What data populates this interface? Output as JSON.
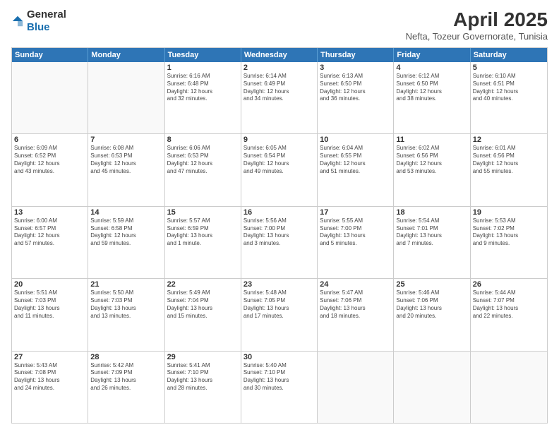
{
  "logo": {
    "general": "General",
    "blue": "Blue"
  },
  "title": {
    "month": "April 2025",
    "location": "Nefta, Tozeur Governorate, Tunisia"
  },
  "header": {
    "days": [
      "Sunday",
      "Monday",
      "Tuesday",
      "Wednesday",
      "Thursday",
      "Friday",
      "Saturday"
    ]
  },
  "rows": [
    [
      {
        "day": "",
        "text": ""
      },
      {
        "day": "",
        "text": ""
      },
      {
        "day": "1",
        "text": "Sunrise: 6:16 AM\nSunset: 6:48 PM\nDaylight: 12 hours\nand 32 minutes."
      },
      {
        "day": "2",
        "text": "Sunrise: 6:14 AM\nSunset: 6:49 PM\nDaylight: 12 hours\nand 34 minutes."
      },
      {
        "day": "3",
        "text": "Sunrise: 6:13 AM\nSunset: 6:50 PM\nDaylight: 12 hours\nand 36 minutes."
      },
      {
        "day": "4",
        "text": "Sunrise: 6:12 AM\nSunset: 6:50 PM\nDaylight: 12 hours\nand 38 minutes."
      },
      {
        "day": "5",
        "text": "Sunrise: 6:10 AM\nSunset: 6:51 PM\nDaylight: 12 hours\nand 40 minutes."
      }
    ],
    [
      {
        "day": "6",
        "text": "Sunrise: 6:09 AM\nSunset: 6:52 PM\nDaylight: 12 hours\nand 43 minutes."
      },
      {
        "day": "7",
        "text": "Sunrise: 6:08 AM\nSunset: 6:53 PM\nDaylight: 12 hours\nand 45 minutes."
      },
      {
        "day": "8",
        "text": "Sunrise: 6:06 AM\nSunset: 6:53 PM\nDaylight: 12 hours\nand 47 minutes."
      },
      {
        "day": "9",
        "text": "Sunrise: 6:05 AM\nSunset: 6:54 PM\nDaylight: 12 hours\nand 49 minutes."
      },
      {
        "day": "10",
        "text": "Sunrise: 6:04 AM\nSunset: 6:55 PM\nDaylight: 12 hours\nand 51 minutes."
      },
      {
        "day": "11",
        "text": "Sunrise: 6:02 AM\nSunset: 6:56 PM\nDaylight: 12 hours\nand 53 minutes."
      },
      {
        "day": "12",
        "text": "Sunrise: 6:01 AM\nSunset: 6:56 PM\nDaylight: 12 hours\nand 55 minutes."
      }
    ],
    [
      {
        "day": "13",
        "text": "Sunrise: 6:00 AM\nSunset: 6:57 PM\nDaylight: 12 hours\nand 57 minutes."
      },
      {
        "day": "14",
        "text": "Sunrise: 5:59 AM\nSunset: 6:58 PM\nDaylight: 12 hours\nand 59 minutes."
      },
      {
        "day": "15",
        "text": "Sunrise: 5:57 AM\nSunset: 6:59 PM\nDaylight: 13 hours\nand 1 minute."
      },
      {
        "day": "16",
        "text": "Sunrise: 5:56 AM\nSunset: 7:00 PM\nDaylight: 13 hours\nand 3 minutes."
      },
      {
        "day": "17",
        "text": "Sunrise: 5:55 AM\nSunset: 7:00 PM\nDaylight: 13 hours\nand 5 minutes."
      },
      {
        "day": "18",
        "text": "Sunrise: 5:54 AM\nSunset: 7:01 PM\nDaylight: 13 hours\nand 7 minutes."
      },
      {
        "day": "19",
        "text": "Sunrise: 5:53 AM\nSunset: 7:02 PM\nDaylight: 13 hours\nand 9 minutes."
      }
    ],
    [
      {
        "day": "20",
        "text": "Sunrise: 5:51 AM\nSunset: 7:03 PM\nDaylight: 13 hours\nand 11 minutes."
      },
      {
        "day": "21",
        "text": "Sunrise: 5:50 AM\nSunset: 7:03 PM\nDaylight: 13 hours\nand 13 minutes."
      },
      {
        "day": "22",
        "text": "Sunrise: 5:49 AM\nSunset: 7:04 PM\nDaylight: 13 hours\nand 15 minutes."
      },
      {
        "day": "23",
        "text": "Sunrise: 5:48 AM\nSunset: 7:05 PM\nDaylight: 13 hours\nand 17 minutes."
      },
      {
        "day": "24",
        "text": "Sunrise: 5:47 AM\nSunset: 7:06 PM\nDaylight: 13 hours\nand 18 minutes."
      },
      {
        "day": "25",
        "text": "Sunrise: 5:46 AM\nSunset: 7:06 PM\nDaylight: 13 hours\nand 20 minutes."
      },
      {
        "day": "26",
        "text": "Sunrise: 5:44 AM\nSunset: 7:07 PM\nDaylight: 13 hours\nand 22 minutes."
      }
    ],
    [
      {
        "day": "27",
        "text": "Sunrise: 5:43 AM\nSunset: 7:08 PM\nDaylight: 13 hours\nand 24 minutes."
      },
      {
        "day": "28",
        "text": "Sunrise: 5:42 AM\nSunset: 7:09 PM\nDaylight: 13 hours\nand 26 minutes."
      },
      {
        "day": "29",
        "text": "Sunrise: 5:41 AM\nSunset: 7:10 PM\nDaylight: 13 hours\nand 28 minutes."
      },
      {
        "day": "30",
        "text": "Sunrise: 5:40 AM\nSunset: 7:10 PM\nDaylight: 13 hours\nand 30 minutes."
      },
      {
        "day": "",
        "text": ""
      },
      {
        "day": "",
        "text": ""
      },
      {
        "day": "",
        "text": ""
      }
    ]
  ]
}
